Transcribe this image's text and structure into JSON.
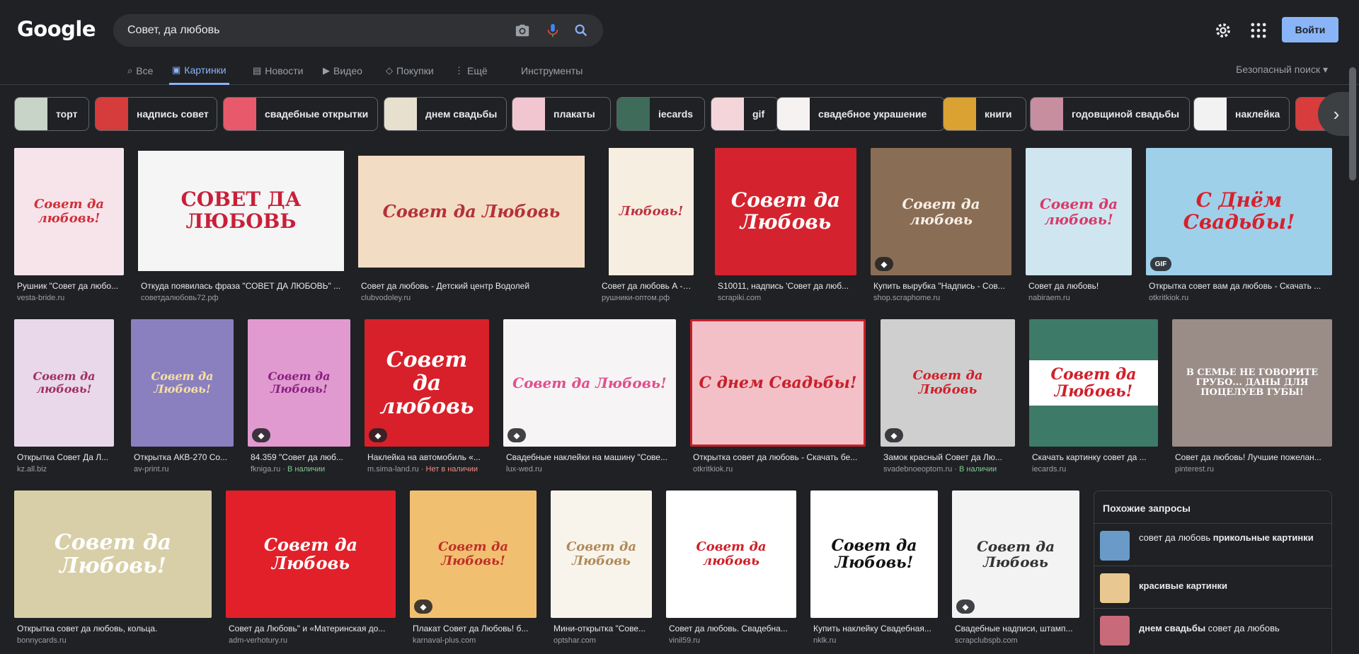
{
  "header": {
    "logo": "Google",
    "search_value": "Совет, да любовь",
    "signin_label": "Войти"
  },
  "tabs": [
    {
      "label": "Все",
      "icon": "search-icon"
    },
    {
      "label": "Картинки",
      "icon": "images-icon",
      "active": true
    },
    {
      "label": "Новости",
      "icon": "news-icon"
    },
    {
      "label": "Видео",
      "icon": "video-icon"
    },
    {
      "label": "Покупки",
      "icon": "tag-icon"
    },
    {
      "label": "Ещё",
      "icon": "more-icon"
    },
    {
      "label": "Инструменты"
    }
  ],
  "safe_search": "Безопасный поиск",
  "chips": [
    {
      "label": "торт",
      "color": "#c9d4c9"
    },
    {
      "label": "надпись совет",
      "color": "#d63c3c"
    },
    {
      "label": "свадебные открытки",
      "color": "#e85a6b"
    },
    {
      "label": "днем свадьбы",
      "color": "#e7e0cf"
    },
    {
      "label": "плакаты",
      "color": "#f2c6d0"
    },
    {
      "label": "iecards",
      "color": "#3e6b5a"
    },
    {
      "label": "gif",
      "color": "#f4d6da"
    },
    {
      "label": "свадебное украшение",
      "color": "#f7f2f2"
    },
    {
      "label": "книги",
      "color": "#d9a233"
    },
    {
      "label": "годовщиной свадьбы",
      "color": "#c78ea0"
    },
    {
      "label": "наклейка",
      "color": "#f2f2f2"
    },
    {
      "label": "",
      "color": "#d93c3c"
    }
  ],
  "results": [
    {
      "title": "Рушник \"Совет да любо...",
      "source": "vesta-bride.ru",
      "art": "Совет да любовь!",
      "bg": "#f7e4ea",
      "fg": "#d0303a"
    },
    {
      "title": "Откуда появилась фраза \"СОВЕТ ДА ЛЮБОВЬ\" ...",
      "source": "советдалюбовь72.рф",
      "art": "СОВЕТ ДА ЛЮБОВЬ",
      "bg": "#f5f5f5",
      "fg": "#c8203a"
    },
    {
      "title": "Совет да любовь - Детский центр Водолей",
      "source": "clubvodoley.ru",
      "art": "Совет да Любовь",
      "bg": "#f3dcc4",
      "fg": "#b3323a"
    },
    {
      "title": "Совет да любовь А -2...",
      "source": "рушники-оптом.рф",
      "art": "Любовь!",
      "bg": "#f6eee0",
      "fg": "#c03040"
    },
    {
      "title": "S10011, надпись 'Совет да люб...",
      "source": "scrapiki.com",
      "art": "Совет да Любовь",
      "bg": "#d4232e",
      "fg": "#ffffff"
    },
    {
      "title": "Купить вырубка \"Надпись - Сов...",
      "source": "shop.scraphome.ru",
      "art": "Совет да любовь",
      "bg": "#8a6d55",
      "fg": "#f5efe6"
    },
    {
      "title": "Совет да любовь!",
      "source": "nabiraem.ru",
      "art": "Совет да любовь!",
      "bg": "#cfe6f0",
      "fg": "#d83a6a"
    },
    {
      "title": "Открытка совет вам да любовь - Скачать ...",
      "source": "otkritkiok.ru",
      "art": "С Днём Свадьбы!",
      "bg": "#9ed0ea",
      "fg": "#d8202a"
    },
    {
      "title": "Открытка Совет Да Л...",
      "source": "kz.all.biz",
      "art": "Совет да любовь!",
      "bg": "#e8d8ea",
      "fg": "#a03060"
    },
    {
      "title": "Открытка АКВ-270 Со...",
      "source": "av-print.ru",
      "art": "Совет да Любовь!",
      "bg": "#8a80c0",
      "fg": "#f7e0a0"
    },
    {
      "title": "84.359 \"Совет да люб...",
      "source": "fkniga.ru",
      "avail": "В наличии",
      "avail_class": "ok",
      "art": "Совет да Любовь!",
      "bg": "#e09ad0",
      "fg": "#8a2080"
    },
    {
      "title": "Наклейка на автомобиль «...",
      "source": "m.sima-land.ru",
      "avail": "Нет в наличии",
      "avail_class": "no",
      "art": "Совет да любовь",
      "bg": "#d8202a",
      "fg": "#ffffff"
    },
    {
      "title": "Свадебные наклейки на машину \"Сове...",
      "source": "lux-wed.ru",
      "art": "Совет да Любовь!",
      "bg": "#f7f4f6",
      "fg": "#e0508a"
    },
    {
      "title": "Открытка совет да любовь - Скачать бе...",
      "source": "otkritkiok.ru",
      "art": "С днем Свадьбы!",
      "bg": "#f3c0c8",
      "fg": "#c8202a"
    },
    {
      "title": "Замок красный Совет да Лю...",
      "source": "svadebnoeoptom.ru",
      "avail": "В наличии",
      "avail_class": "ok",
      "art": "Совет да Любовь",
      "bg": "#cfcfcf",
      "fg": "#d0202a"
    },
    {
      "title": "Скачать картинку совет да ...",
      "source": "iecards.ru",
      "art": "Совет да Любовь!",
      "bg": "#3e7a68",
      "fg": "#d0202a"
    },
    {
      "title": "Совет да любовь! Лучшие пожелан...",
      "source": "pinterest.ru",
      "art": "В СЕМЬЕ НЕ ГОВОРИТЕ ГРУБО... ДАНЫ ДЛЯ ПОЦЕЛУЕВ ГУБЫ!",
      "bg": "#9a8c86",
      "fg": "#ffffff"
    },
    {
      "title": "Открытка совет да любовь, кольца.",
      "source": "bonnycards.ru",
      "art": "Совет да Любовь!",
      "bg": "#d8cfa8",
      "fg": "#ffffff"
    },
    {
      "title": "Совет да Любовь\" и «Материнская до...",
      "source": "adm-verhotury.ru",
      "art": "Совет да Любовь",
      "bg": "#e2202a",
      "fg": "#ffffff"
    },
    {
      "title": "Плакат Совет да Любовь! б...",
      "source": "karnaval-plus.com",
      "art": "Совет да Любовь!",
      "bg": "#f0c070",
      "fg": "#c0302a"
    },
    {
      "title": "Мини-открытка \"Сове...",
      "source": "optshar.com",
      "art": "Совет да Любовь",
      "bg": "#f8f4ec",
      "fg": "#b08a5a"
    },
    {
      "title": "Совет да любовь. Свадебна...",
      "source": "vinil59.ru",
      "art": "Совет да любовь",
      "bg": "#ffffff",
      "fg": "#d0202a"
    },
    {
      "title": "Купить наклейку Свадебная...",
      "source": "nklk.ru",
      "art": "Совет да Любовь!",
      "bg": "#ffffff",
      "fg": "#111111"
    },
    {
      "title": "Свадебные надписи, штамп...",
      "source": "scrapclubspb.com",
      "art": "Совет да Любовь",
      "bg": "#f3f3f3",
      "fg": "#333333"
    }
  ],
  "related": {
    "heading": "Похожие запросы",
    "items": [
      {
        "plain": "совет да любовь ",
        "bold": "прикольные картинки",
        "color": "#6a9ac8"
      },
      {
        "plain": "",
        "bold": "красивые картинки",
        "color": "#e8c890"
      },
      {
        "bold_first": "днем свадьбы",
        "plain": " совет да любовь",
        "color": "#c86a7a"
      }
    ]
  }
}
